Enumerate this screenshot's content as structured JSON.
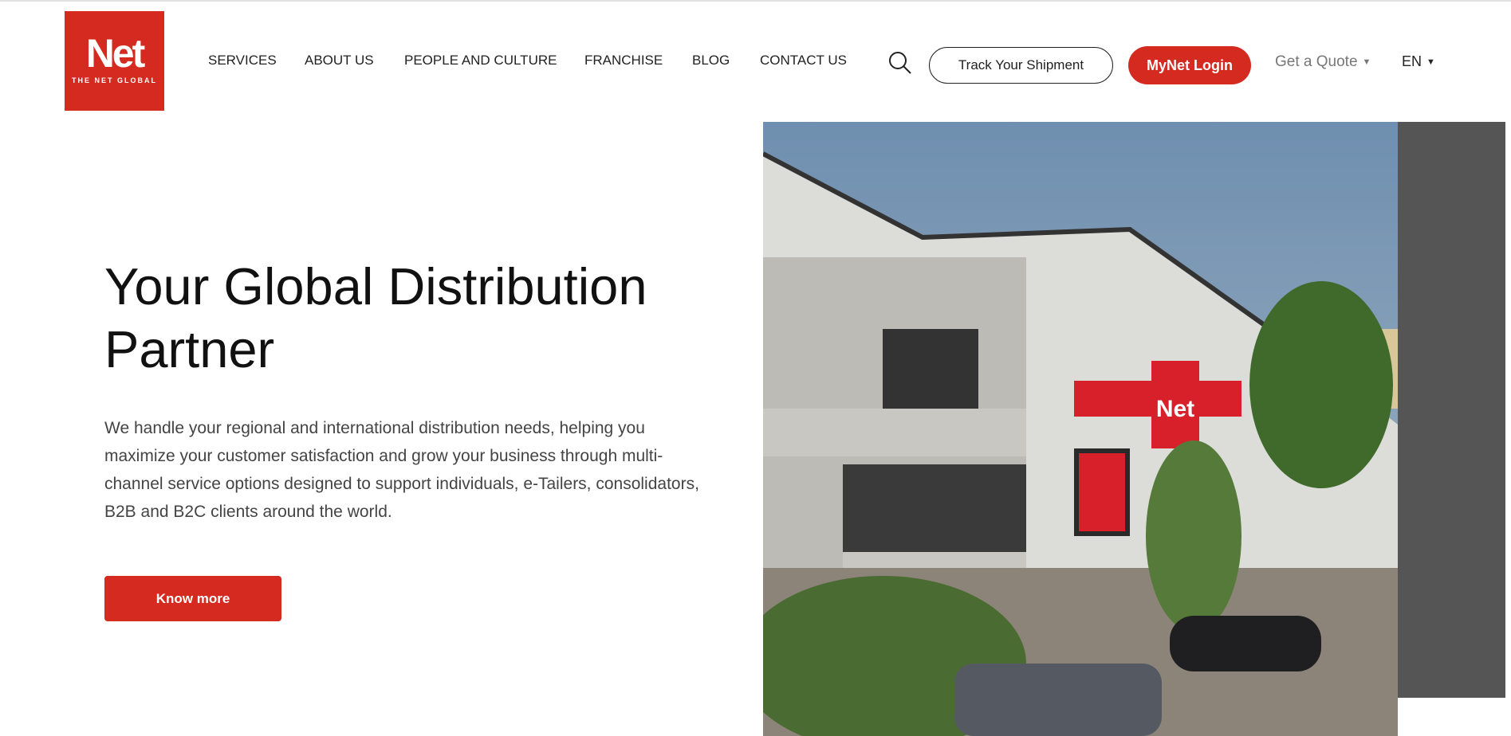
{
  "header": {
    "logo_text": "Net",
    "logo_tagline": "THE NET GLOBAL",
    "nav": [
      "SERVICES",
      "ABOUT US",
      "PEOPLE AND CULTURE",
      "FRANCHISE",
      "BLOG",
      "CONTACT US"
    ],
    "search_icon": "search-icon",
    "track_label": "Track Your Shipment",
    "login_label": "MyNet Login",
    "quote_label": "Get a Quote",
    "lang_label": "EN"
  },
  "hero": {
    "title": "Your Global Distribution Partner",
    "description": "We handle your regional and international distribution needs, helping you maximize your customer satisfaction and grow your business through multi-channel service options designed to support individuals, e-Tailers, consolidators, B2B and B2C clients around the world.",
    "cta_label": "Know more",
    "sign_text": "Net"
  },
  "colors": {
    "brand": "#d42a20",
    "panel": "#555555"
  }
}
